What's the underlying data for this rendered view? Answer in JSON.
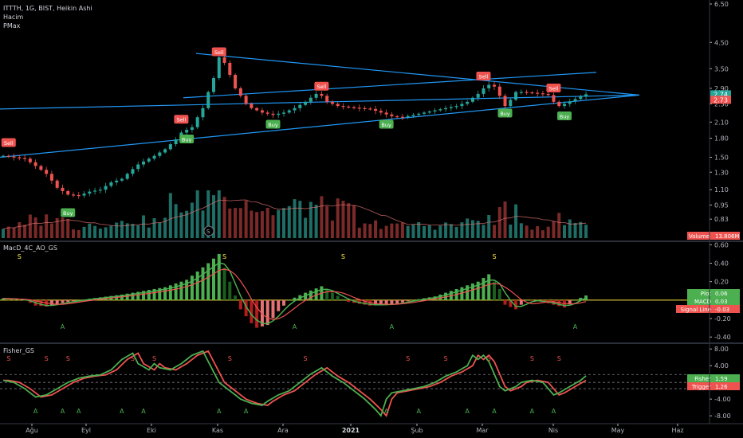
{
  "symbol_line": "ITTTH, 1G, BIST, Heikin Ashi",
  "main_indicators": [
    "Hacim",
    "PMax"
  ],
  "macd_title": "MacD_4C_AO_GS",
  "fisher_title": "Fisher_GS",
  "x_axis_labels": [
    "Ağu",
    "Eyl",
    "Eki",
    "Kas",
    "Ara",
    "2021",
    "Şub",
    "Mar",
    "Nis",
    "May",
    "Haz"
  ],
  "colors": {
    "background": "#000000",
    "up": "#26a69a",
    "down": "#ef5350",
    "trend_line": "#2196f3",
    "macd_up": "#4caf50",
    "macd_down": "#b71c1c",
    "zero_line": "#ffeb3b",
    "signal_s": "#ffeb3b",
    "signal_a": "#4caf50",
    "fisher": "#4caf50",
    "trigger": "#ef5350"
  },
  "chart_data": [
    {
      "type": "candlestick",
      "title": "ITTTH, 1G, BIST, Heikin Ashi",
      "y_ticks": [
        "6.50",
        "4.50",
        "3.50",
        "2.90",
        "2.50",
        "2.10",
        "1.80",
        "1.50",
        "1.30",
        "1.10",
        "0.95",
        "0.83"
      ],
      "price_path": [
        [
          0,
          1.52
        ],
        [
          4,
          1.48
        ],
        [
          8,
          1.28
        ],
        [
          10,
          1.12
        ],
        [
          12,
          1.05
        ],
        [
          14,
          1.04
        ],
        [
          16,
          1.08
        ],
        [
          18,
          1.1
        ],
        [
          20,
          1.18
        ],
        [
          22,
          1.22
        ],
        [
          25,
          1.4
        ],
        [
          28,
          1.52
        ],
        [
          30,
          1.62
        ],
        [
          32,
          1.78
        ],
        [
          33,
          1.9
        ],
        [
          35,
          2.0
        ],
        [
          37,
          2.4
        ],
        [
          39,
          3.2
        ],
        [
          40,
          3.9
        ],
        [
          41,
          3.7
        ],
        [
          42,
          3.3
        ],
        [
          43,
          2.9
        ],
        [
          44,
          2.7
        ],
        [
          45,
          2.5
        ],
        [
          46,
          2.4
        ],
        [
          48,
          2.3
        ],
        [
          50,
          2.25
        ],
        [
          52,
          2.3
        ],
        [
          54,
          2.4
        ],
        [
          56,
          2.55
        ],
        [
          58,
          2.75
        ],
        [
          59,
          2.7
        ],
        [
          60,
          2.55
        ],
        [
          62,
          2.45
        ],
        [
          64,
          2.42
        ],
        [
          66,
          2.4
        ],
        [
          68,
          2.38
        ],
        [
          70,
          2.3
        ],
        [
          72,
          2.22
        ],
        [
          74,
          2.2
        ],
        [
          76,
          2.25
        ],
        [
          78,
          2.3
        ],
        [
          80,
          2.35
        ],
        [
          82,
          2.4
        ],
        [
          84,
          2.45
        ],
        [
          86,
          2.55
        ],
        [
          88,
          2.75
        ],
        [
          89,
          2.9
        ],
        [
          90,
          3.0
        ],
        [
          91,
          2.95
        ],
        [
          92,
          2.7
        ],
        [
          93,
          2.45
        ],
        [
          94,
          2.6
        ],
        [
          95,
          2.8
        ],
        [
          96,
          2.8
        ],
        [
          98,
          2.78
        ],
        [
          100,
          2.75
        ],
        [
          101,
          2.72
        ],
        [
          102,
          2.55
        ],
        [
          103,
          2.45
        ],
        [
          104,
          2.5
        ],
        [
          106,
          2.62
        ],
        [
          108,
          2.74
        ]
      ],
      "markers": [
        {
          "label": "Sell",
          "x": 1,
          "price": 1.72
        },
        {
          "label": "Buy",
          "x": 12,
          "price": 0.88
        },
        {
          "label": "Sell",
          "x": 33,
          "price": 2.15
        },
        {
          "label": "Buy",
          "x": 34,
          "price": 1.78
        },
        {
          "label": "Sell",
          "x": 40,
          "price": 4.1
        },
        {
          "label": "Buy",
          "x": 50,
          "price": 2.05
        },
        {
          "label": "Sell",
          "x": 59,
          "price": 2.95
        },
        {
          "label": "Buy",
          "x": 71,
          "price": 2.05
        },
        {
          "label": "Sell",
          "x": 89,
          "price": 3.25
        },
        {
          "label": "Buy",
          "x": 93,
          "price": 2.28
        },
        {
          "label": "Sell",
          "x": 102,
          "price": 2.9
        },
        {
          "label": "Buy",
          "x": 104,
          "price": 2.22
        }
      ],
      "price_labels": [
        {
          "text": "2.74",
          "price": 2.74,
          "color": "#26a69a"
        },
        {
          "text": "2.73",
          "price": 2.6,
          "color": "#ef5350"
        }
      ],
      "volume_label": {
        "name": "Volume",
        "value": "13.806M"
      }
    },
    {
      "type": "bar",
      "title": "MacD_4C_AO_GS",
      "y_ticks": [
        "0.60",
        "0.40",
        "0.20",
        "-0.20",
        "-0.40"
      ],
      "ylim": [
        -0.45,
        0.62
      ],
      "histogram_path": [
        [
          0,
          0.02
        ],
        [
          4,
          0.0
        ],
        [
          6,
          -0.06
        ],
        [
          8,
          -0.07
        ],
        [
          10,
          -0.04
        ],
        [
          14,
          0.0
        ],
        [
          18,
          0.03
        ],
        [
          22,
          0.06
        ],
        [
          26,
          0.1
        ],
        [
          30,
          0.14
        ],
        [
          34,
          0.22
        ],
        [
          38,
          0.4
        ],
        [
          40,
          0.5
        ],
        [
          41,
          0.35
        ],
        [
          43,
          0.05
        ],
        [
          44,
          -0.1
        ],
        [
          46,
          -0.25
        ],
        [
          47,
          -0.3
        ],
        [
          49,
          -0.27
        ],
        [
          51,
          -0.12
        ],
        [
          53,
          0.0
        ],
        [
          56,
          0.08
        ],
        [
          59,
          0.15
        ],
        [
          61,
          0.08
        ],
        [
          64,
          -0.02
        ],
        [
          68,
          -0.06
        ],
        [
          72,
          -0.05
        ],
        [
          76,
          0.0
        ],
        [
          80,
          0.04
        ],
        [
          84,
          0.12
        ],
        [
          88,
          0.2
        ],
        [
          90,
          0.28
        ],
        [
          92,
          0.12
        ],
        [
          93,
          -0.05
        ],
        [
          95,
          -0.1
        ],
        [
          97,
          0.0
        ],
        [
          100,
          -0.02
        ],
        [
          102,
          -0.05
        ],
        [
          104,
          -0.08
        ],
        [
          106,
          0.0
        ],
        [
          108,
          0.05
        ]
      ],
      "legend": [
        {
          "name": "Plot",
          "value": "0.06",
          "color": "#4caf50"
        },
        {
          "name": "MACD",
          "value": "0.03",
          "color": "#4caf50"
        },
        {
          "name": "Signal Line",
          "value": "-0.03",
          "color": "#ef5350"
        }
      ],
      "signals": [
        {
          "label": "S",
          "x": 3,
          "pos": "top"
        },
        {
          "label": "S",
          "x": 41,
          "pos": "top"
        },
        {
          "label": "S",
          "x": 63,
          "pos": "top"
        },
        {
          "label": "S",
          "x": 91,
          "pos": "top"
        },
        {
          "label": "A",
          "x": 11,
          "pos": "bottom"
        },
        {
          "label": "A",
          "x": 54,
          "pos": "bottom"
        },
        {
          "label": "A",
          "x": 72,
          "pos": "bottom"
        },
        {
          "label": "A",
          "x": 106,
          "pos": "bottom"
        }
      ]
    },
    {
      "type": "line",
      "title": "Fisher_GS",
      "y_ticks": [
        "8.00",
        "4.00",
        "-4.00",
        "-8.00"
      ],
      "ylim": [
        -9.5,
        9.0
      ],
      "fisher_path": [
        [
          0,
          0.5
        ],
        [
          2,
          0.0
        ],
        [
          4,
          -1.5
        ],
        [
          6,
          -3.5
        ],
        [
          8,
          -3.0
        ],
        [
          10,
          -1.5
        ],
        [
          12,
          0.0
        ],
        [
          14,
          1.0
        ],
        [
          16,
          1.5
        ],
        [
          18,
          1.8
        ],
        [
          20,
          3.0
        ],
        [
          22,
          5.5
        ],
        [
          24,
          7.0
        ],
        [
          25,
          4.5
        ],
        [
          27,
          3.0
        ],
        [
          28,
          4.5
        ],
        [
          29,
          3.5
        ],
        [
          31,
          3.0
        ],
        [
          33,
          4.5
        ],
        [
          35,
          6.5
        ],
        [
          37,
          7.5
        ],
        [
          38,
          5.0
        ],
        [
          40,
          0.0
        ],
        [
          42,
          -2.0
        ],
        [
          44,
          -4.0
        ],
        [
          46,
          -5.0
        ],
        [
          48,
          -5.5
        ],
        [
          49,
          -4.5
        ],
        [
          51,
          -3.0
        ],
        [
          53,
          -2.0
        ],
        [
          55,
          0.0
        ],
        [
          57,
          2.0
        ],
        [
          59,
          3.5
        ],
        [
          61,
          1.5
        ],
        [
          63,
          0.0
        ],
        [
          65,
          -2.0
        ],
        [
          67,
          -4.0
        ],
        [
          69,
          -6.5
        ],
        [
          70,
          -8.0
        ],
        [
          71,
          -4.0
        ],
        [
          72,
          -2.5
        ],
        [
          74,
          -2.0
        ],
        [
          76,
          -1.5
        ],
        [
          78,
          -1.0
        ],
        [
          80,
          0.0
        ],
        [
          82,
          1.5
        ],
        [
          84,
          2.5
        ],
        [
          86,
          4.0
        ],
        [
          87,
          6.5
        ],
        [
          88,
          5.5
        ],
        [
          89,
          6.5
        ],
        [
          90,
          5.0
        ],
        [
          91,
          2.0
        ],
        [
          92,
          -1.0
        ],
        [
          93,
          -2.0
        ],
        [
          95,
          -1.0
        ],
        [
          96,
          0.0
        ],
        [
          98,
          0.5
        ],
        [
          100,
          0.0
        ],
        [
          101,
          -1.5
        ],
        [
          102,
          -3.0
        ],
        [
          103,
          -2.5
        ],
        [
          105,
          -1.0
        ],
        [
          107,
          0.5
        ],
        [
          108,
          1.59
        ]
      ],
      "dashed_levels": [
        1.9,
        0.0,
        -1.5
      ],
      "legend": [
        {
          "name": "Fisher",
          "value": "1.59",
          "color": "#4caf50"
        },
        {
          "name": "Trigger",
          "value": "1.26",
          "color": "#ef5350"
        }
      ],
      "signals": [
        {
          "label": "S",
          "x": 1,
          "pos": "top"
        },
        {
          "label": "S",
          "x": 8,
          "pos": "top"
        },
        {
          "label": "S",
          "x": 12,
          "pos": "top"
        },
        {
          "label": "S",
          "x": 24,
          "pos": "top"
        },
        {
          "label": "S",
          "x": 28,
          "pos": "top"
        },
        {
          "label": "S",
          "x": 42,
          "pos": "top"
        },
        {
          "label": "S",
          "x": 56,
          "pos": "top"
        },
        {
          "label": "S",
          "x": 75,
          "pos": "top"
        },
        {
          "label": "S",
          "x": 82,
          "pos": "top"
        },
        {
          "label": "S",
          "x": 90,
          "pos": "top"
        },
        {
          "label": "S",
          "x": 98,
          "pos": "top"
        },
        {
          "label": "S",
          "x": 103,
          "pos": "top"
        },
        {
          "label": "A",
          "x": 6,
          "pos": "bottom"
        },
        {
          "label": "A",
          "x": 11,
          "pos": "bottom"
        },
        {
          "label": "A",
          "x": 14,
          "pos": "bottom"
        },
        {
          "label": "A",
          "x": 22,
          "pos": "bottom"
        },
        {
          "label": "A",
          "x": 26,
          "pos": "bottom"
        },
        {
          "label": "A",
          "x": 40,
          "pos": "bottom"
        },
        {
          "label": "A",
          "x": 45,
          "pos": "bottom"
        },
        {
          "label": "A",
          "x": 71,
          "pos": "bottom"
        },
        {
          "label": "A",
          "x": 77,
          "pos": "bottom"
        },
        {
          "label": "A",
          "x": 86,
          "pos": "bottom"
        },
        {
          "label": "A",
          "x": 91,
          "pos": "bottom"
        },
        {
          "label": "A",
          "x": 98,
          "pos": "bottom"
        },
        {
          "label": "A",
          "x": 102,
          "pos": "bottom"
        }
      ]
    }
  ]
}
